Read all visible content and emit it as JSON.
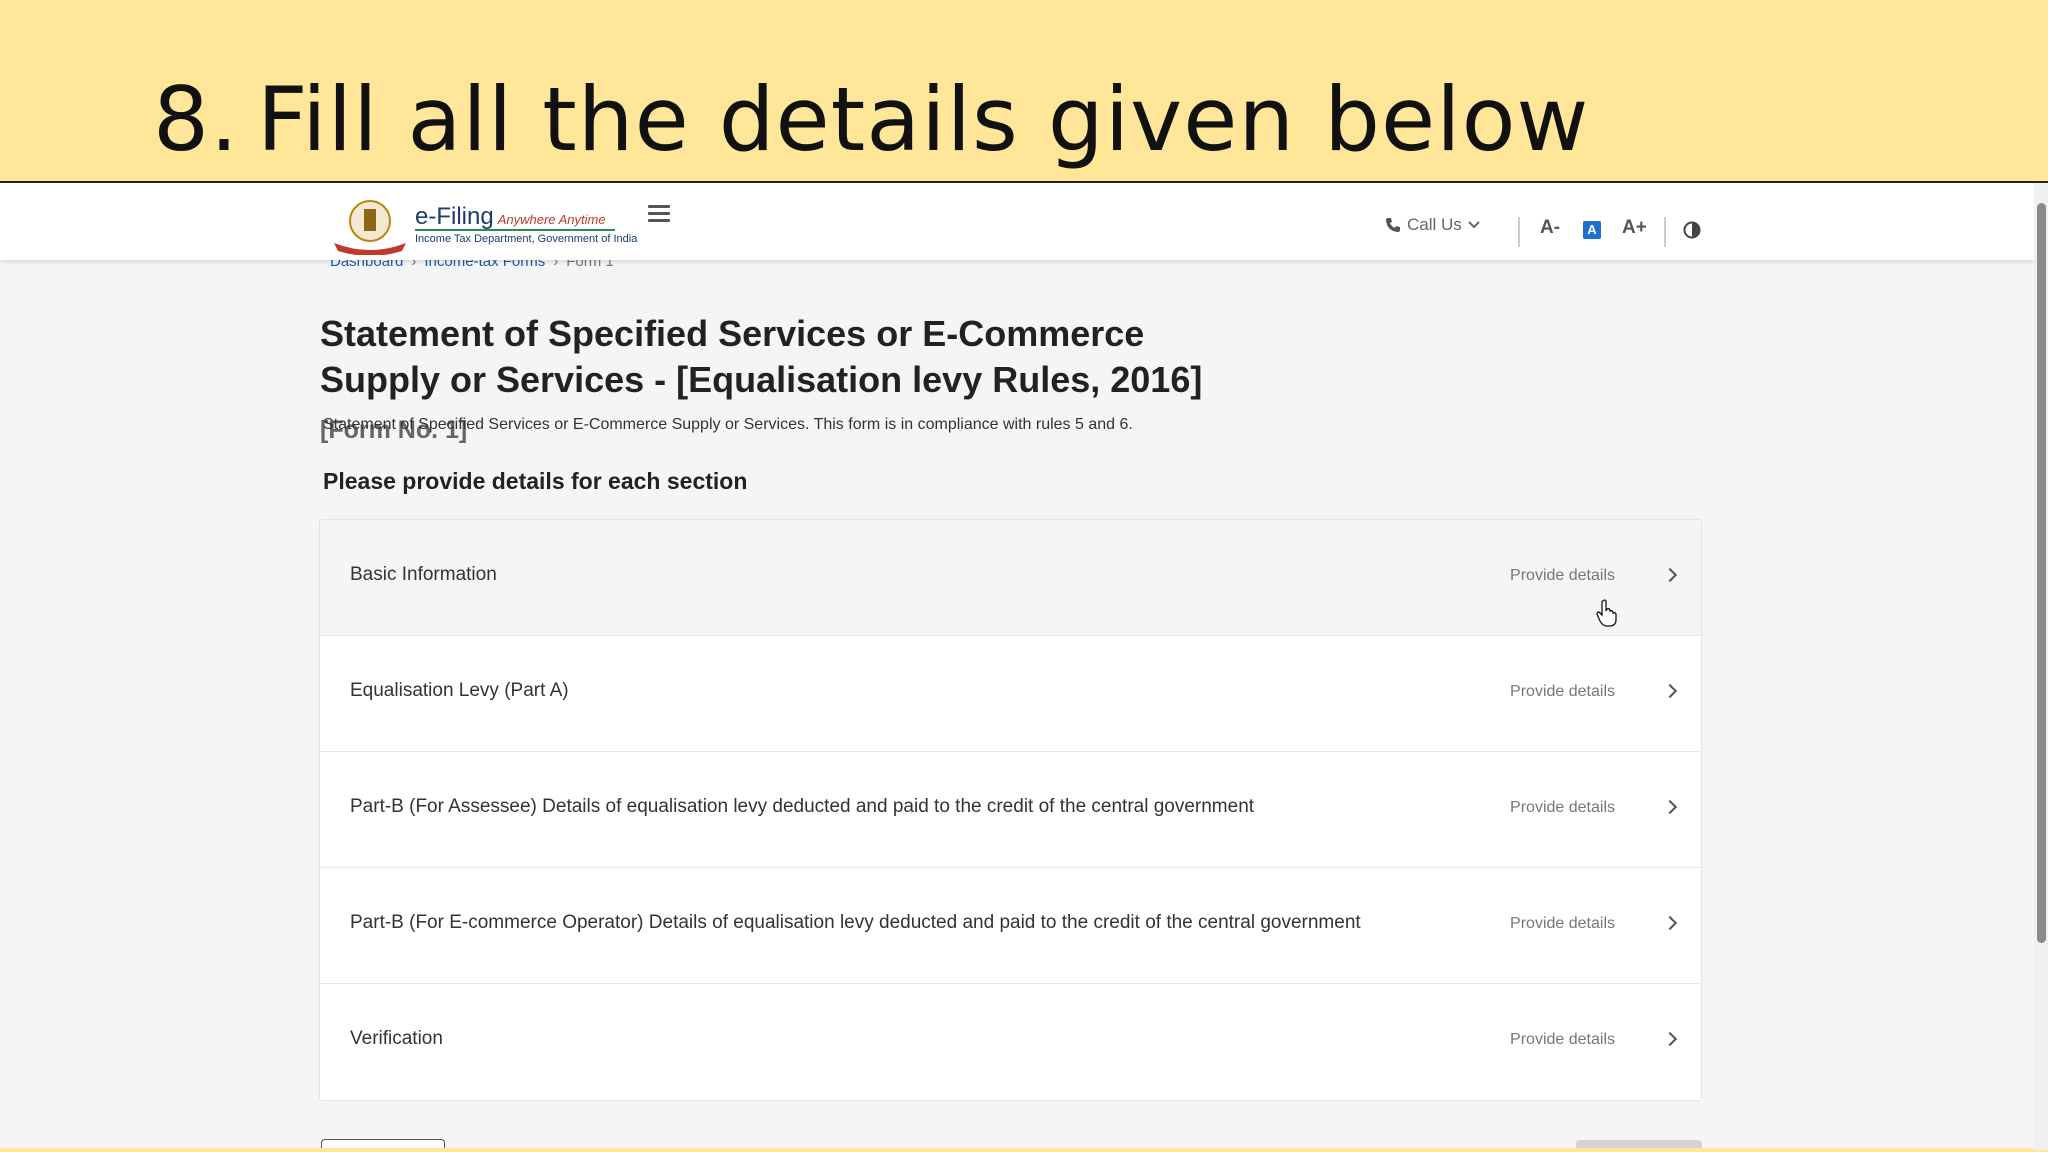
{
  "slide": {
    "step_number": "8.",
    "title": "Fill all the details given below"
  },
  "header": {
    "logo_main": "e-Filing",
    "logo_tagline": "Anywhere Anytime",
    "logo_sub": "Income Tax Department, Government of India",
    "call_us": "Call Us",
    "decrease_font": "A-",
    "default_font": "A",
    "increase_font": "A+"
  },
  "breadcrumb": [
    "Dashboard",
    "Income-tax Forms",
    "Form 1"
  ],
  "page": {
    "title": "Statement of Specified Services or E-Commerce Supply or Services - [Equalisation levy Rules, 2016]",
    "form_no": "[Form No. 1]",
    "description": "Statement of Specified Services or E-Commerce Supply or Services. This form is in compliance with rules 5 and 6.",
    "section_heading": "Please provide details for each section"
  },
  "sections": [
    {
      "label": "Basic Information",
      "action": "Provide details"
    },
    {
      "label": "Equalisation Levy (Part A)",
      "action": "Provide details"
    },
    {
      "label": "Part-B (For Assessee) Details of equalisation levy deducted and paid to the credit of the central government",
      "action": "Provide details"
    },
    {
      "label": "Part-B (For E-commerce Operator) Details of equalisation levy deducted and paid to the credit of the central government",
      "action": "Provide details"
    },
    {
      "label": "Verification",
      "action": "Provide details"
    }
  ],
  "colors": {
    "slide_background": "#ffe699",
    "link": "#1e5aa8",
    "accent": "#1e6fd0"
  }
}
